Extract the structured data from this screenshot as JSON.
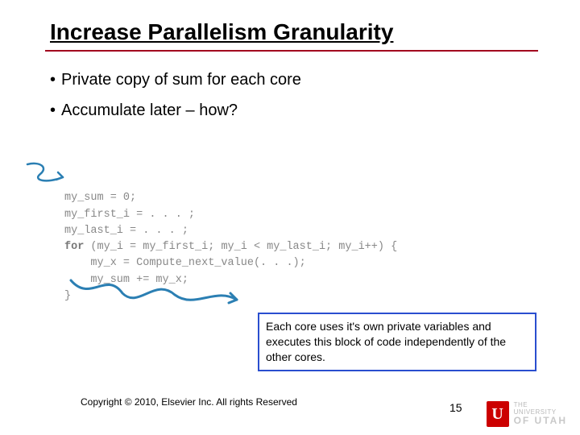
{
  "title": "Increase Parallelism Granularity",
  "bullets": [
    "Private copy of sum for each core",
    "Accumulate later – how?"
  ],
  "code_lines": [
    "my_sum = 0;",
    "my_first_i = . . . ;",
    "my_last_i = . . . ;",
    "for (my_i = my_first_i; my_i < my_last_i; my_i++) {",
    "    my_x = Compute_next_value(. . .);",
    "    my_sum += my_x;",
    "}"
  ],
  "callout": "Each core uses it's own private variables and executes this block of code independently of the other cores.",
  "copyright": "Copyright © 2010, Elsevier Inc. All rights Reserved",
  "page_number": "15",
  "logo": {
    "line1": "THE",
    "line2": "UNIVERSITY",
    "line3": "OF UTAH",
    "mark": "U"
  }
}
